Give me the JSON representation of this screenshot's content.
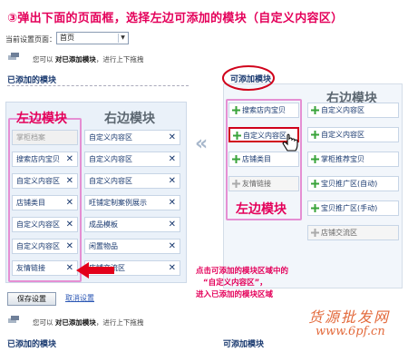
{
  "step_title": "③弹出下面的页面框，选择左边可添加的模块（自定义内容区）",
  "current_page": {
    "label": "当前设置页面：",
    "value": "首页"
  },
  "hint": {
    "prefix": "您可以",
    "bold": "对已添加模块",
    "suffix": "，进行上下拖拽"
  },
  "added_modules_title": "已添加的模块",
  "available_modules_title": "可添加模块",
  "left_region_label": "左边模块",
  "right_region_label": "右边模块",
  "left_modules": [
    {
      "label": "掌柜档案",
      "removable": false
    },
    {
      "label": "搜索店内宝贝",
      "removable": true
    },
    {
      "label": "自定义内容区",
      "removable": true
    },
    {
      "label": "店铺类目",
      "removable": true
    },
    {
      "label": "自定义内容区",
      "removable": true
    },
    {
      "label": "自定义内容区",
      "removable": true
    },
    {
      "label": "友情链接",
      "removable": true
    }
  ],
  "right_modules": [
    {
      "label": "自定义内容区",
      "removable": true
    },
    {
      "label": "自定义内容区",
      "removable": true
    },
    {
      "label": "自定义内容区",
      "removable": true
    },
    {
      "label": "旺铺定制案例展示",
      "removable": true
    },
    {
      "label": "成品模板",
      "removable": true
    },
    {
      "label": "闲置物品",
      "removable": true
    },
    {
      "label": "店铺交流区",
      "removable": true
    }
  ],
  "available_left": [
    {
      "label": "搜索店内宝贝",
      "enabled": true
    },
    {
      "label": "自定义内容区",
      "enabled": true,
      "highlighted": true
    },
    {
      "label": "店铺类目",
      "enabled": true
    },
    {
      "label": "友情链接",
      "enabled": false
    }
  ],
  "available_right": [
    {
      "label": "自定义内容区",
      "enabled": true
    },
    {
      "label": "自定义内容区",
      "enabled": true
    },
    {
      "label": "掌柜推荐宝贝",
      "enabled": true
    },
    {
      "label": "宝贝推广区(自动)",
      "enabled": true
    },
    {
      "label": "宝贝推广区(手动)",
      "enabled": true
    },
    {
      "label": "店铺交流区",
      "enabled": false
    }
  ],
  "annotation": {
    "line1": "点击可添加的模块区域中的",
    "line2": "“自定义内容区”，",
    "line3": "进入已添加的模块区域"
  },
  "save_label": "保存设置",
  "cancel_label": "取消设置",
  "watermark": {
    "cn": "货源批发网",
    "url": "www.6pf.cn"
  },
  "colors": {
    "accent": "#e4005a",
    "link": "#2a56b4",
    "plus_green": "#39a33a",
    "region_frame": "#e58fd3",
    "highlight": "#d0021b"
  },
  "icons": {
    "remove": "close-icon",
    "add": "plus-icon",
    "drag": "drag-icon",
    "cursor": "hand-pointer-icon",
    "arrow": "red-arrow-icon"
  }
}
